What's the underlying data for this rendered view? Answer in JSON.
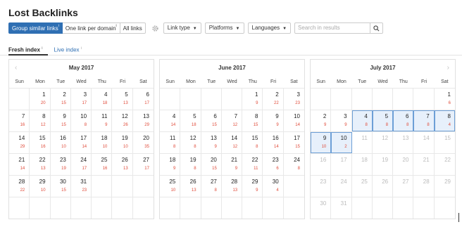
{
  "page_title": "Lost Backlinks",
  "toolbar": {
    "group_similar": "Group similar links",
    "one_link": "One link per domain",
    "all_links": "All links",
    "info_mark": "i",
    "link_type": "Link type",
    "platforms": "Platforms",
    "languages": "Languages",
    "search_placeholder": "Search in results",
    "accent": "#2f6fb3"
  },
  "tabs": {
    "fresh": "Fresh index",
    "live": "Live index",
    "info_mark": "i"
  },
  "weekdays": [
    "Sun",
    "Mon",
    "Tue",
    "Wed",
    "Thu",
    "Fri",
    "Sat"
  ],
  "calendars": [
    {
      "month": "May 2017",
      "rows": [
        [
          null,
          [
            "1",
            "20"
          ],
          [
            "2",
            "15"
          ],
          [
            "3",
            "17"
          ],
          [
            "4",
            "18"
          ],
          [
            "5",
            "13"
          ],
          [
            "6",
            "17"
          ]
        ],
        [
          [
            "7",
            "16"
          ],
          [
            "8",
            "12"
          ],
          [
            "9",
            "15"
          ],
          [
            "10",
            "8"
          ],
          [
            "11",
            "9"
          ],
          [
            "12",
            "26"
          ],
          [
            "13",
            "29"
          ]
        ],
        [
          [
            "14",
            "29"
          ],
          [
            "15",
            "16"
          ],
          [
            "16",
            "10"
          ],
          [
            "17",
            "14"
          ],
          [
            "18",
            "10"
          ],
          [
            "19",
            "10"
          ],
          [
            "20",
            "35"
          ]
        ],
        [
          [
            "21",
            "14"
          ],
          [
            "22",
            "13"
          ],
          [
            "23",
            "19"
          ],
          [
            "24",
            "17"
          ],
          [
            "25",
            "16"
          ],
          [
            "26",
            "13"
          ],
          [
            "27",
            "17"
          ]
        ],
        [
          [
            "28",
            "22"
          ],
          [
            "29",
            "10"
          ],
          [
            "30",
            "15"
          ],
          [
            "31",
            "23"
          ],
          null,
          null,
          null
        ],
        [
          null,
          null,
          null,
          null,
          null,
          null,
          null
        ]
      ]
    },
    {
      "month": "June 2017",
      "rows": [
        [
          null,
          null,
          null,
          null,
          [
            "1",
            "9"
          ],
          [
            "2",
            "22"
          ],
          [
            "3",
            "23"
          ]
        ],
        [
          [
            "4",
            "14"
          ],
          [
            "5",
            "18"
          ],
          [
            "6",
            "15"
          ],
          [
            "7",
            "12"
          ],
          [
            "8",
            "15"
          ],
          [
            "9",
            "9"
          ],
          [
            "10",
            "14"
          ]
        ],
        [
          [
            "11",
            "8"
          ],
          [
            "12",
            "8"
          ],
          [
            "13",
            "9"
          ],
          [
            "14",
            "12"
          ],
          [
            "15",
            "8"
          ],
          [
            "16",
            "14"
          ],
          [
            "17",
            "15"
          ]
        ],
        [
          [
            "18",
            "9"
          ],
          [
            "19",
            "8"
          ],
          [
            "20",
            "15"
          ],
          [
            "21",
            "9"
          ],
          [
            "22",
            "11"
          ],
          [
            "23",
            "6"
          ],
          [
            "24",
            "8"
          ]
        ],
        [
          [
            "25",
            "10"
          ],
          [
            "26",
            "13"
          ],
          [
            "27",
            "8"
          ],
          [
            "28",
            "13"
          ],
          [
            "29",
            "9"
          ],
          [
            "30",
            "4"
          ],
          null
        ],
        [
          null,
          null,
          null,
          null,
          null,
          null,
          null
        ]
      ]
    },
    {
      "month": "July 2017",
      "rows": [
        [
          null,
          null,
          null,
          null,
          null,
          null,
          [
            "1",
            "6"
          ]
        ],
        [
          [
            "2",
            "9"
          ],
          [
            "3",
            "9"
          ],
          [
            "4",
            "8"
          ],
          [
            "5",
            "8"
          ],
          [
            "6",
            "8"
          ],
          [
            "7",
            "8"
          ],
          [
            "8",
            "4"
          ]
        ],
        [
          [
            "9",
            "10"
          ],
          [
            "10",
            "2"
          ],
          [
            "11",
            ""
          ],
          [
            "12",
            ""
          ],
          [
            "13",
            ""
          ],
          [
            "14",
            ""
          ],
          [
            "15",
            ""
          ]
        ],
        [
          [
            "16",
            ""
          ],
          [
            "17",
            ""
          ],
          [
            "18",
            ""
          ],
          [
            "19",
            ""
          ],
          [
            "20",
            ""
          ],
          [
            "21",
            ""
          ],
          [
            "22",
            ""
          ]
        ],
        [
          [
            "23",
            ""
          ],
          [
            "24",
            ""
          ],
          [
            "25",
            ""
          ],
          [
            "26",
            ""
          ],
          [
            "27",
            ""
          ],
          [
            "28",
            ""
          ],
          [
            "29",
            ""
          ]
        ],
        [
          [
            "30",
            ""
          ],
          [
            "31",
            ""
          ],
          null,
          null,
          null,
          null,
          null
        ]
      ]
    }
  ]
}
